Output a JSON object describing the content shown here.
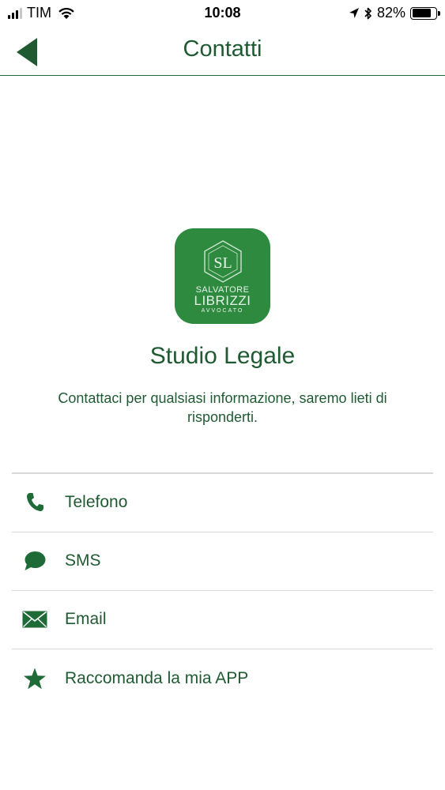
{
  "status_bar": {
    "carrier": "TIM",
    "time": "10:08",
    "battery_percent": "82%",
    "battery_level": 0.82,
    "icons": [
      "signal-icon",
      "wifi-icon",
      "location-arrow-icon",
      "bluetooth-icon",
      "battery-icon"
    ]
  },
  "nav": {
    "title": "Contatti",
    "back_icon": "back-arrow-icon"
  },
  "logo": {
    "monogram": "SL",
    "line1": "SALVATORE",
    "line2": "LIBRIZZI",
    "line3": "AVVOCATO"
  },
  "studio": {
    "title": "Studio Legale",
    "description": "Contattaci per qualsiasi informazione, saremo lieti di risponderti."
  },
  "contacts": [
    {
      "label": "Telefono",
      "icon": "phone-icon"
    },
    {
      "label": "SMS",
      "icon": "chat-bubble-icon"
    },
    {
      "label": "Email",
      "icon": "envelope-icon"
    },
    {
      "label": "Raccomanda la mia APP",
      "icon": "star-icon"
    }
  ],
  "colors": {
    "accent": "#1f6b37",
    "text": "#1f5a32",
    "logo_bg": "#2d8a3e",
    "divider": "#d8d8d8"
  }
}
